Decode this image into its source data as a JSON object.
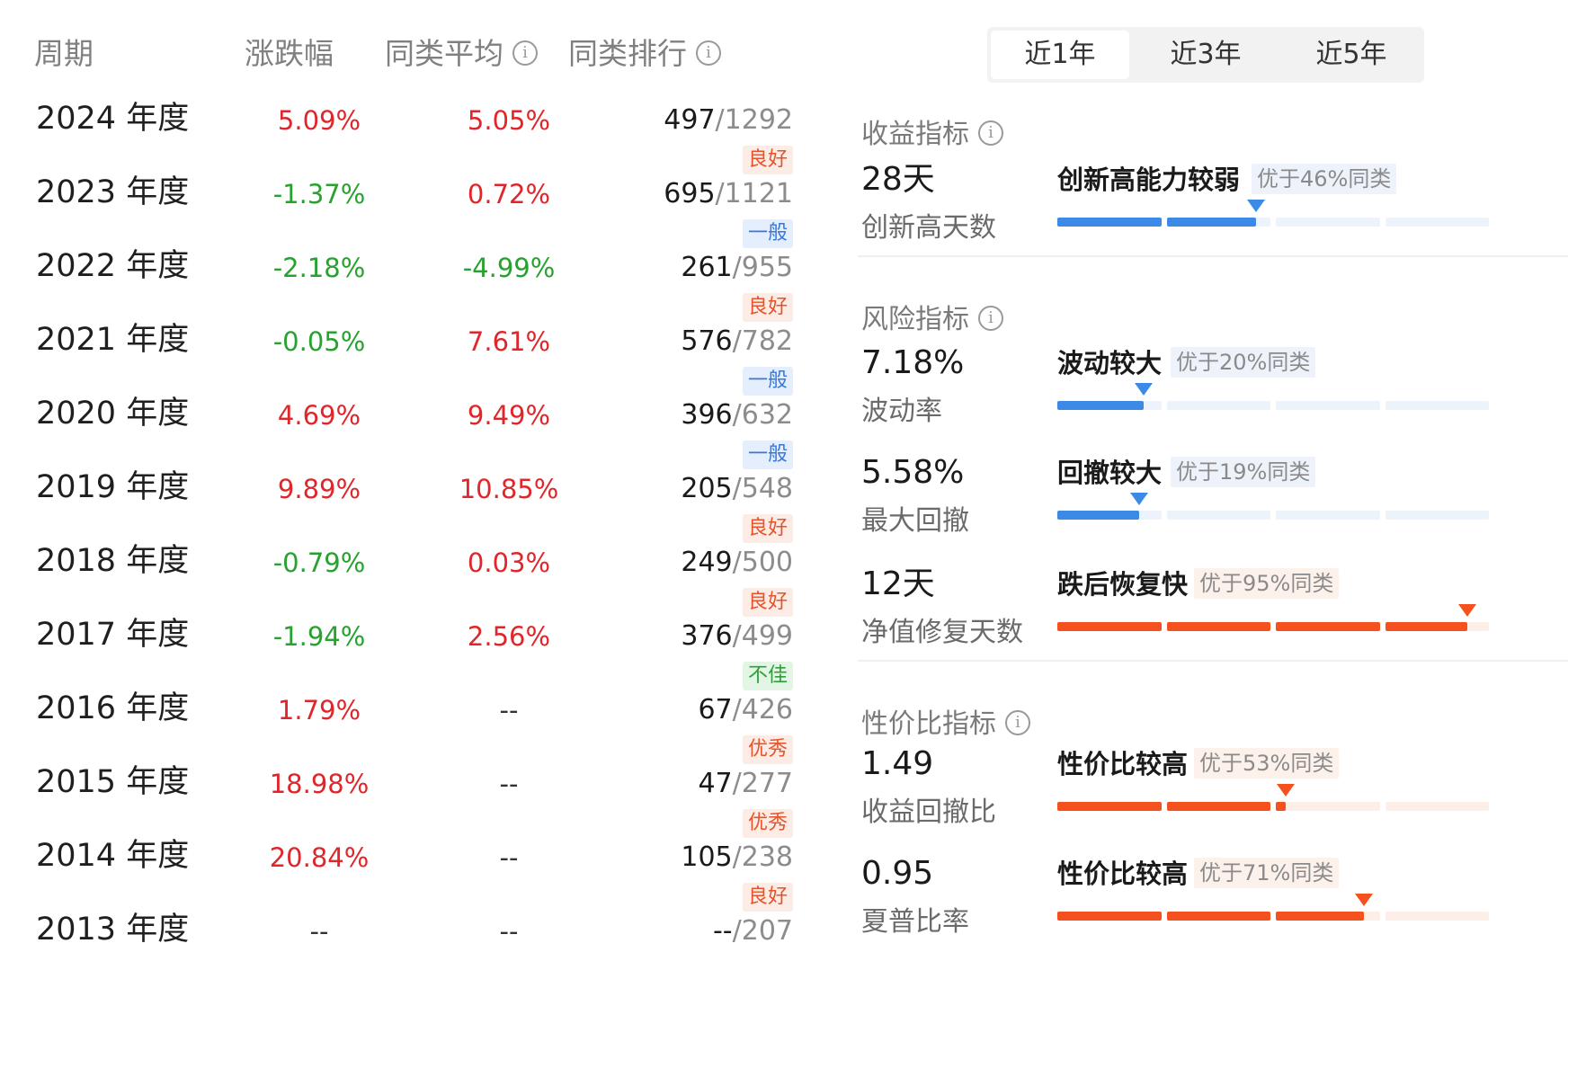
{
  "table": {
    "headers": {
      "period": "周期",
      "change": "涨跌幅",
      "avg": "同类平均",
      "rank": "同类排行"
    },
    "rows": [
      {
        "period": "2024 年度",
        "change": "5.09%",
        "change_color": "red",
        "avg": "5.05%",
        "avg_color": "red",
        "rank_num": "497",
        "rank_total": "/1292",
        "badge": "良好",
        "badge_type": "good"
      },
      {
        "period": "2023 年度",
        "change": "-1.37%",
        "change_color": "green",
        "avg": "0.72%",
        "avg_color": "red",
        "rank_num": "695",
        "rank_total": "/1121",
        "badge": "一般",
        "badge_type": "avg"
      },
      {
        "period": "2022 年度",
        "change": "-2.18%",
        "change_color": "green",
        "avg": "-4.99%",
        "avg_color": "green",
        "rank_num": "261",
        "rank_total": "/955",
        "badge": "良好",
        "badge_type": "good"
      },
      {
        "period": "2021 年度",
        "change": "-0.05%",
        "change_color": "green",
        "avg": "7.61%",
        "avg_color": "red",
        "rank_num": "576",
        "rank_total": "/782",
        "badge": "一般",
        "badge_type": "avg"
      },
      {
        "period": "2020 年度",
        "change": "4.69%",
        "change_color": "red",
        "avg": "9.49%",
        "avg_color": "red",
        "rank_num": "396",
        "rank_total": "/632",
        "badge": "一般",
        "badge_type": "avg"
      },
      {
        "period": "2019 年度",
        "change": "9.89%",
        "change_color": "red",
        "avg": "10.85%",
        "avg_color": "red",
        "rank_num": "205",
        "rank_total": "/548",
        "badge": "良好",
        "badge_type": "good"
      },
      {
        "period": "2018 年度",
        "change": "-0.79%",
        "change_color": "green",
        "avg": "0.03%",
        "avg_color": "red",
        "rank_num": "249",
        "rank_total": "/500",
        "badge": "良好",
        "badge_type": "good"
      },
      {
        "period": "2017 年度",
        "change": "-1.94%",
        "change_color": "green",
        "avg": "2.56%",
        "avg_color": "red",
        "rank_num": "376",
        "rank_total": "/499",
        "badge": "不佳",
        "badge_type": "bad"
      },
      {
        "period": "2016 年度",
        "change": "1.79%",
        "change_color": "red",
        "avg": "--",
        "avg_color": "dash",
        "rank_num": "67",
        "rank_total": "/426",
        "badge": "优秀",
        "badge_type": "good"
      },
      {
        "period": "2015 年度",
        "change": "18.98%",
        "change_color": "red",
        "avg": "--",
        "avg_color": "dash",
        "rank_num": "47",
        "rank_total": "/277",
        "badge": "优秀",
        "badge_type": "good"
      },
      {
        "period": "2014 年度",
        "change": "20.84%",
        "change_color": "red",
        "avg": "--",
        "avg_color": "dash",
        "rank_num": "105",
        "rank_total": "/238",
        "badge": "良好",
        "badge_type": "good"
      },
      {
        "period": "2013 年度",
        "change": "--",
        "change_color": "dash",
        "avg": "--",
        "avg_color": "dash",
        "rank_num": "--",
        "rank_total": "/207",
        "badge": "",
        "badge_type": ""
      }
    ]
  },
  "tabs": [
    "近1年",
    "近3年",
    "近5年"
  ],
  "active_tab": "近1年",
  "sections": {
    "return": {
      "title": "收益指标"
    },
    "risk": {
      "title": "风险指标"
    },
    "value": {
      "title": "性价比指标"
    }
  },
  "metrics": [
    {
      "value": "28天",
      "name": "创新高天数",
      "verdict": "创新高能力较弱",
      "better": "优于46%同类",
      "percentile": 46,
      "color": "blue"
    },
    {
      "value": "7.18%",
      "name": "波动率",
      "verdict": "波动较大",
      "better": "优于20%同类",
      "percentile": 20,
      "color": "blue"
    },
    {
      "value": "5.58%",
      "name": "最大回撤",
      "verdict": "回撤较大",
      "better": "优于19%同类",
      "percentile": 19,
      "color": "blue"
    },
    {
      "value": "12天",
      "name": "净值修复天数",
      "verdict": "跌后恢复快",
      "better": "优于95%同类",
      "percentile": 95,
      "color": "orange"
    },
    {
      "value": "1.49",
      "name": "收益回撤比",
      "verdict": "性价比较高",
      "better": "优于53%同类",
      "percentile": 53,
      "color": "orange"
    },
    {
      "value": "0.95",
      "name": "夏普比率",
      "verdict": "性价比较高",
      "better": "优于71%同类",
      "percentile": 71,
      "color": "orange"
    }
  ],
  "colors": {
    "up": "#e0262a",
    "down": "#27a22f",
    "bar_blue": "#3a8ae6",
    "bar_blue_bg": "#edf3fb",
    "bar_orange": "#f4511e",
    "bar_orange_bg": "#fdeee8"
  },
  "icons": {
    "info": "info-circle-icon",
    "marker": "triangle-down-icon"
  }
}
